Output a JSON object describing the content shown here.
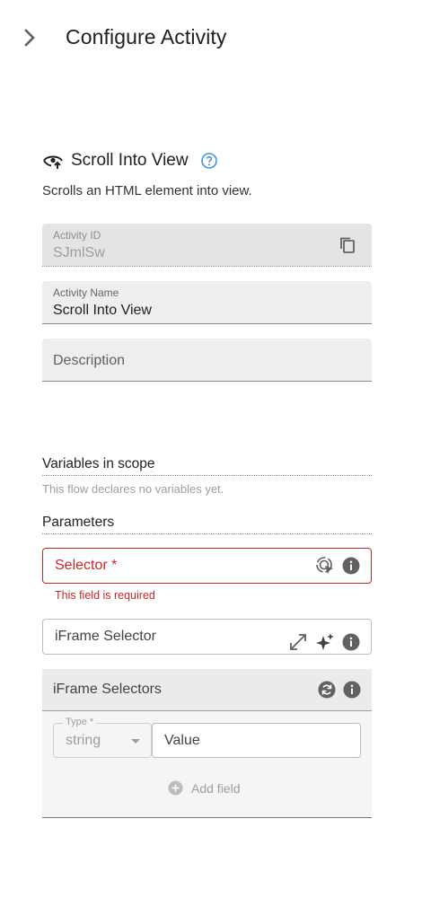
{
  "header": {
    "title": "Configure Activity"
  },
  "activity": {
    "title": "Scroll Into View",
    "description": "Scrolls an HTML element into view."
  },
  "fields": {
    "activity_id": {
      "label": "Activity ID",
      "value": "SJmlSw"
    },
    "activity_name": {
      "label": "Activity Name",
      "value": "Scroll Into View"
    },
    "description": {
      "placeholder": "Description"
    }
  },
  "variables": {
    "title": "Variables in scope",
    "note": "This flow declares no variables yet."
  },
  "parameters": {
    "title": "Parameters",
    "selector": {
      "label": "Selector *",
      "error": "This field is required"
    },
    "iframe_selector": {
      "label": "iFrame Selector"
    },
    "iframe_selectors": {
      "label": "iFrame Selectors",
      "type_label": "Type *",
      "type_value": "string",
      "value_placeholder": "Value",
      "add_field_label": "Add field"
    }
  },
  "colors": {
    "error": "#c62828",
    "help": "#4a90d9",
    "field_bg": "#eeeeee"
  },
  "icons": {
    "collapse": "chevron-right-icon",
    "activity": "eye-scroll-icon",
    "help": "help-circle-icon",
    "copy": "copy-icon",
    "picker": "element-picker-icon",
    "info": "info-icon",
    "expand": "expand-diagonal-icon",
    "ai": "sparkle-icon",
    "refresh": "refresh-circle-icon",
    "add": "add-circle-icon"
  }
}
